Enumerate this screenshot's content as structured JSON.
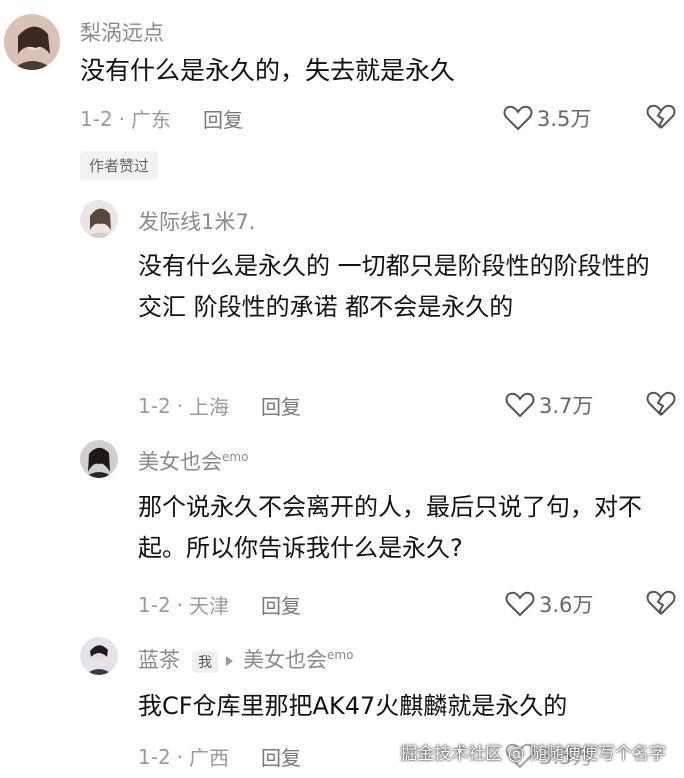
{
  "comments": [
    {
      "user": "梨涡远点",
      "text": "没有什么是永久的，失去就是永久",
      "date": "1-2",
      "location": "广东",
      "reply_label": "回复",
      "likes": "3.5万",
      "badge": "作者赞过"
    },
    {
      "user": "发际线1米7.",
      "text": "没有什么是永久的 一切都只是阶段性的阶段性的交汇 阶段性的承诺 都不会是永久的",
      "date": "1-2",
      "location": "上海",
      "reply_label": "回复",
      "likes": "3.7万"
    },
    {
      "user": "美女也会",
      "user_suffix": "emo",
      "text": "那个说永久不会离开的人，最后只说了句，对不起。所以你告诉我什么是永久?",
      "date": "1-2",
      "location": "天津",
      "reply_label": "回复",
      "likes": "3.6万"
    },
    {
      "user": "蓝茶",
      "me_tag": "我",
      "reply_to": "美女也会",
      "reply_to_suffix": "emo",
      "text": "我CF仓库里那把AK47火麒麟就是永久的",
      "date": "1-2",
      "location": "广西",
      "reply_label": "回复",
      "likes": "3.5万"
    }
  ],
  "separator": "·",
  "watermark": "掘金技术社区 @ 随随便便写个名字",
  "colors": {
    "username": "#8a8a8a",
    "meta": "#9a9a9a",
    "text": "#111111",
    "badge_bg": "#f2f2f2"
  },
  "icons": [
    "heart-outline-icon",
    "broken-heart-icon"
  ]
}
